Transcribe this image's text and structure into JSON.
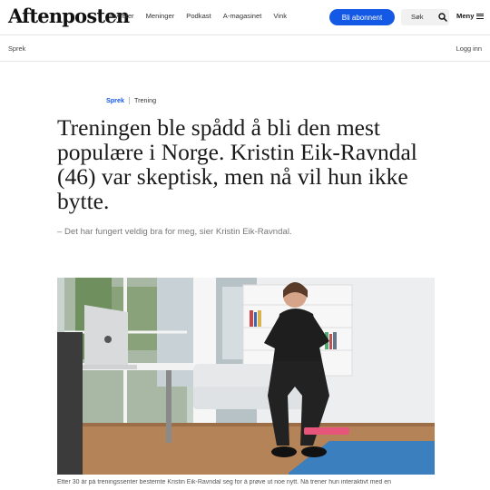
{
  "header": {
    "logo": "Aftenposten",
    "nav": [
      "Nyheter",
      "Meninger",
      "Podkast",
      "A-magasinet",
      "Vink"
    ],
    "subscribe_label": "Bli abonnent",
    "search_label": "Søk",
    "menu_label": "Meny"
  },
  "subbar": {
    "section": "Sprek",
    "login": "Logg inn"
  },
  "article": {
    "kicker_primary": "Sprek",
    "kicker_secondary": "Trening",
    "headline": "Treningen ble spådd å bli den mest populære i Norge. Kristin Eik-Ravndal (46) var skeptisk, men nå vil hun ikke bytte.",
    "lede": "– Det har fungert veldig bra for meg, sier Kristin Eik-Ravndal.",
    "caption": "Etter 30 år på treningssenter bestemte Kristin Eik-Ravndal seg for å prøve ut noe nytt. Nå trener hun interaktivt med en"
  },
  "colors": {
    "accent": "#1458e6",
    "text": "#1a1a1a",
    "muted": "#777777"
  }
}
